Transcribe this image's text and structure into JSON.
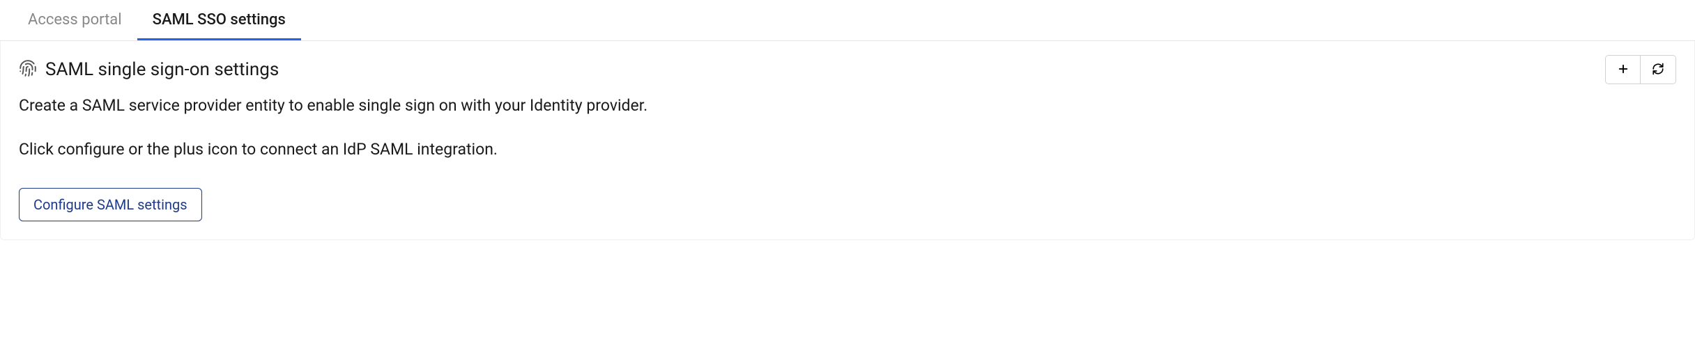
{
  "tabs": [
    {
      "label": "Access portal",
      "active": false
    },
    {
      "label": "SAML SSO settings",
      "active": true
    }
  ],
  "page": {
    "title": "SAML single sign-on settings",
    "description": "Create a SAML service provider entity to enable single sign on with your Identity provider.",
    "instruction": "Click configure or the plus icon to connect an IdP SAML integration.",
    "configure_button": "Configure SAML settings"
  }
}
